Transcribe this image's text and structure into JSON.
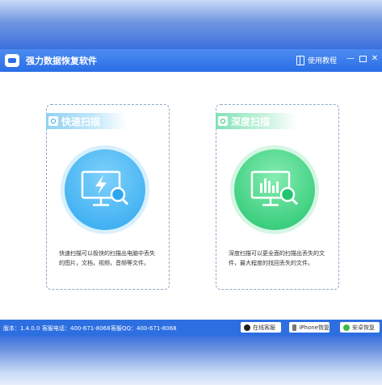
{
  "app": {
    "title": "强力数据恢复软件",
    "tutorial": "使用教程"
  },
  "window_controls": {
    "minimize": "—",
    "close": "✕"
  },
  "cards": {
    "quick": {
      "title": "快速扫描",
      "description": "快速扫描可以极快的扫描出电脑中丢失的图片，文档，视频，音频等文件。",
      "icon": "monitor-lightning-magnifier-icon",
      "color": "#2ea7ef"
    },
    "deep": {
      "title": "深度扫描",
      "description": "深度扫描可以更全面的扫描出丢失的文件，最大程度的找回丢失的文件。",
      "icon": "monitor-chart-magnifier-icon",
      "color": "#22c46e"
    }
  },
  "status": {
    "version": "版本：1.4.0.0",
    "hotline": "客服电话：400-671-8068",
    "qq": "客服QQ：400-671-8068",
    "online_service": "在线客服",
    "iphone_recovery": "iPhone恢复",
    "android_recovery": "安卓恢复"
  },
  "colors": {
    "titlebar": "#2a6ee6",
    "statusbar": "#2d6fe0"
  }
}
